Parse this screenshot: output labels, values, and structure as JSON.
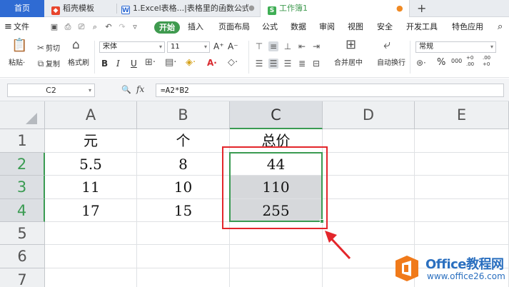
{
  "tabs": {
    "home": "首页",
    "items": [
      {
        "label": "稻壳模板",
        "icon": "docer-icon"
      },
      {
        "label": "1.Excel表格...|表格里的函数公式",
        "icon": "doc-file-icon"
      },
      {
        "label": "工作簿1",
        "icon": "spreadsheet-icon"
      }
    ],
    "new_tab": "+"
  },
  "menu": {
    "file": "文件",
    "start": "开始",
    "items": [
      "插入",
      "页面布局",
      "公式",
      "数据",
      "审阅",
      "视图",
      "安全",
      "开发工具",
      "特色应用"
    ]
  },
  "ribbon": {
    "cut": "剪切",
    "copy": "复制",
    "paste": "粘贴",
    "format_painter": "格式刷",
    "font_name": "宋体",
    "font_size": "11",
    "bold": "B",
    "italic": "I",
    "underline": "U",
    "merge_center": "合并居中",
    "wrap_text": "自动换行",
    "number_format": "常规",
    "percent": "%",
    "thousands": "000",
    "inc_decimal": "+0 .00",
    "dec_decimal": ".00 +0"
  },
  "formula_bar": {
    "name_box": "C2",
    "fx": "fx",
    "formula": "=A2*B2"
  },
  "grid": {
    "columns": [
      "A",
      "B",
      "C",
      "D",
      "E"
    ],
    "selected_column": "C",
    "rows": [
      {
        "num": "1",
        "cells": [
          "元",
          "个",
          "总价",
          "",
          ""
        ]
      },
      {
        "num": "2",
        "cells": [
          "5.5",
          "8",
          "44",
          "",
          ""
        ]
      },
      {
        "num": "3",
        "cells": [
          "11",
          "10",
          "110",
          "",
          ""
        ]
      },
      {
        "num": "4",
        "cells": [
          "17",
          "15",
          "255",
          "",
          ""
        ]
      },
      {
        "num": "5",
        "cells": [
          "",
          "",
          "",
          "",
          ""
        ]
      },
      {
        "num": "6",
        "cells": [
          "",
          "",
          "",
          "",
          ""
        ]
      },
      {
        "num": "7",
        "cells": [
          "",
          "",
          "",
          "",
          ""
        ]
      }
    ],
    "selection_color": "#3a9b52",
    "highlight_color": "#e3262b"
  },
  "watermark": {
    "title": "Office教程网",
    "url": "www.office26.com",
    "logo_color": "#f07a1a"
  }
}
